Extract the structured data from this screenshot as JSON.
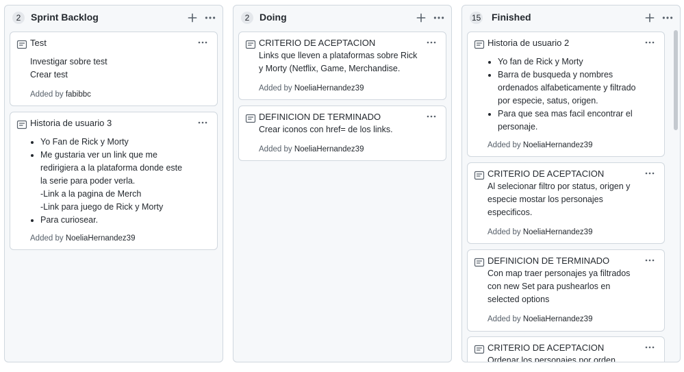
{
  "columns": [
    {
      "title": "Sprint Backlog",
      "count": "2",
      "cards": [
        {
          "title": "Test",
          "lines": [
            "Investigar sobre test",
            "Crear test"
          ],
          "added_label": "Added by",
          "author": "fabibbc"
        },
        {
          "title": "Historia de usuario 3",
          "bullets": [
            "Yo Fan de Rick y Morty",
            "Me gustaria ver un link que me\nredirigiera a la plataforma donde este\nla serie para poder verla.\n-Link a la pagina de Merch\n-Link para juego de Rick y Morty",
            "Para curiosear."
          ],
          "added_label": "Added by",
          "author": "NoeliaHernandez39"
        }
      ]
    },
    {
      "title": "Doing",
      "count": "2",
      "cards": [
        {
          "title": "CRITERIO DE ACEPTACION",
          "lines": [
            "Links que lleven a plataformas sobre Rick",
            "y Morty (Netflix, Game, Merchandise."
          ],
          "added_label": "Added by",
          "author": "NoeliaHernandez39"
        },
        {
          "title": "DEFINICION DE TERMINADO",
          "lines": [
            "Crear iconos con href= de los links."
          ],
          "added_label": "Added by",
          "author": "NoeliaHernandez39"
        }
      ]
    },
    {
      "title": "Finished",
      "count": "15",
      "cards": [
        {
          "title": "Historia de usuario 2",
          "bullets": [
            "Yo fan de Rick y Morty",
            "Barra de busqueda y nombres\nordenados alfabeticamente y filtrado\npor especie, satus, origen.",
            "Para que sea mas facil encontrar el\npersonaje."
          ],
          "added_label": "Added by",
          "author": "NoeliaHernandez39"
        },
        {
          "title": "CRITERIO DE ACEPTACION",
          "lines": [
            "Al selecionar filtro por status, origen y",
            "especie mostar los personajes",
            "especificos."
          ],
          "added_label": "Added by",
          "author": "NoeliaHernandez39"
        },
        {
          "title": "DEFINICION DE TERMINADO",
          "lines": [
            "Con map traer personajes ya filtrados",
            "con new Set para pushearlos en",
            "selected options"
          ],
          "added_label": "Added by",
          "author": "NoeliaHernandez39"
        },
        {
          "title": "CRITERIO DE ACEPTACION",
          "lines": [
            "Ordenar los personajes por orden"
          ]
        }
      ]
    }
  ]
}
